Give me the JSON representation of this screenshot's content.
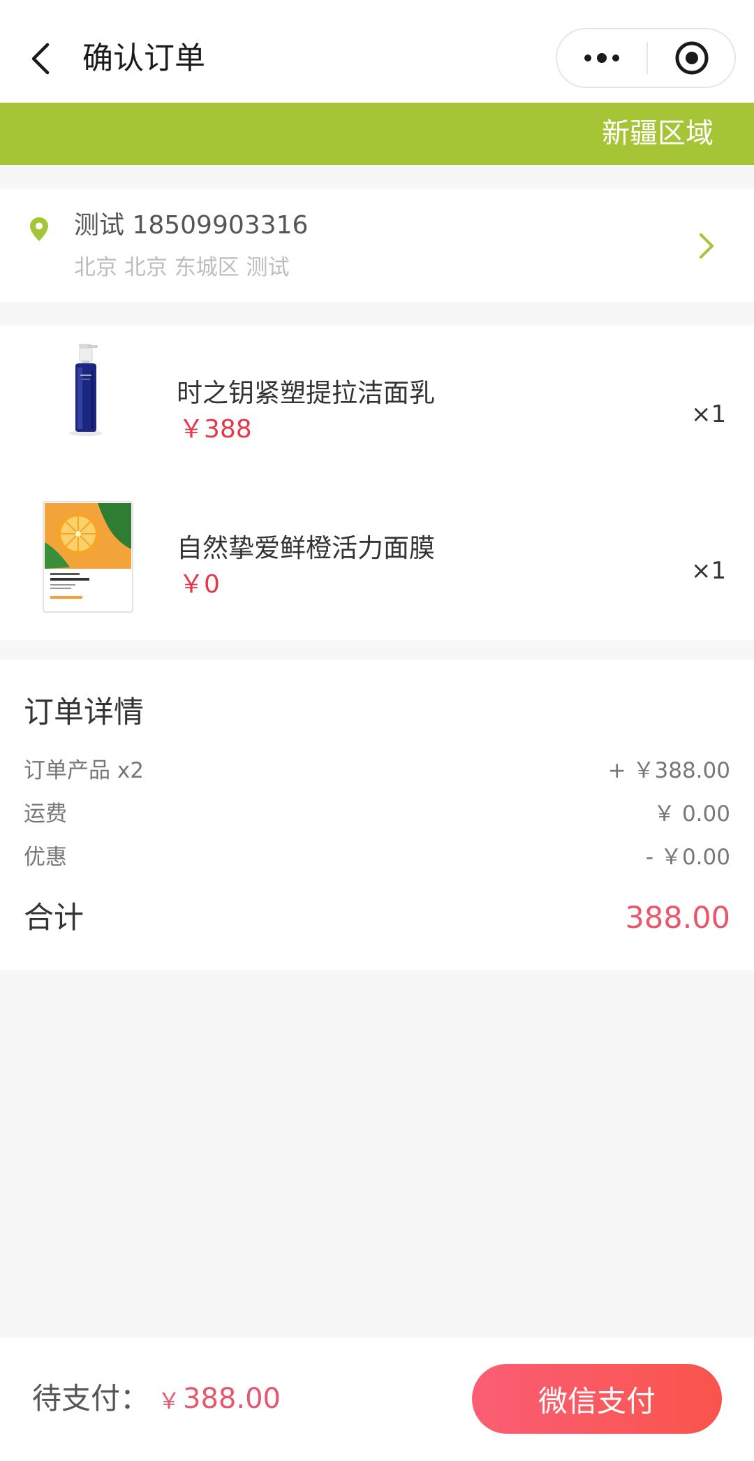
{
  "nav": {
    "title": "确认订单",
    "back_icon": "chevron-left-icon",
    "more_icon": "more-dots-icon",
    "close_icon": "target-icon"
  },
  "banner": {
    "text": "新疆区域",
    "color": "#a5c537"
  },
  "address": {
    "name_phone": "测试 18509903316",
    "detail": "北京 北京 东城区 测试",
    "pin_icon": "location-pin-icon",
    "arrow_icon": "chevron-right-icon",
    "accent": "#a5c537"
  },
  "goods": [
    {
      "name": "时之钥紧塑提拉洁面乳",
      "price": "￥388",
      "qty": "×1",
      "image": "blue-bottle-product"
    },
    {
      "name": "自然挚爱鲜橙活力面膜",
      "price": "￥0",
      "qty": "×1",
      "image": "orange-mask-product"
    }
  ],
  "order_detail": {
    "title": "订单详情",
    "rows": [
      {
        "label": "订单产品 x2",
        "value": "+ ￥388.00"
      },
      {
        "label": "运费",
        "value": "￥ 0.00"
      },
      {
        "label": "优惠",
        "value": "- ￥0.00"
      }
    ],
    "total_label": "合计",
    "total_value": "388.00"
  },
  "footer": {
    "pending_label": "待支付：",
    "currency": "￥",
    "amount": "388.00",
    "pay_button": "微信支付"
  },
  "colors": {
    "price_red": "#e3394a",
    "total_pink": "#e8566b",
    "button_gradient_start": "#fb5e75",
    "button_gradient_end": "#f9544c"
  }
}
